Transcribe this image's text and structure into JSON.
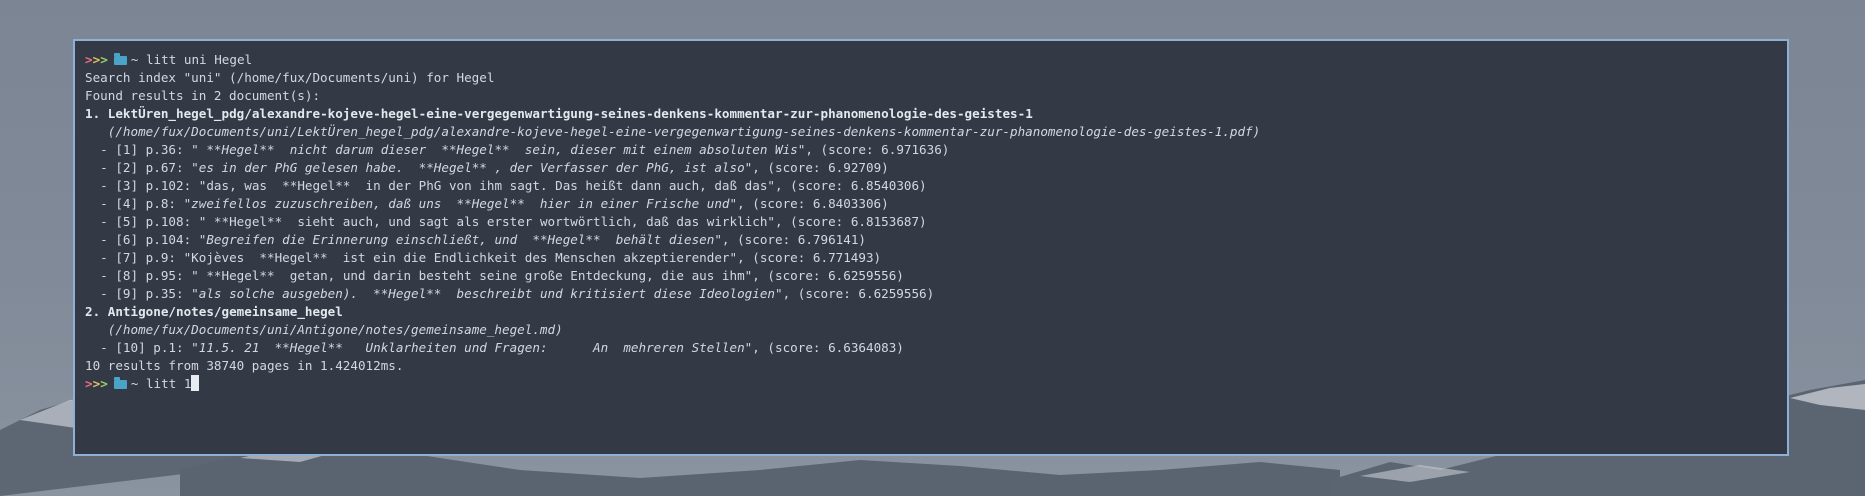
{
  "prompt": {
    "arrows": [
      ">",
      ">",
      ">"
    ],
    "folder_icon": "folder-icon",
    "tilde": "~"
  },
  "commands": {
    "first": "litt uni Hegel",
    "second": "litt 1"
  },
  "output": {
    "search_line": "Search index \"uni\" (/home/fux/Documents/uni) for Hegel",
    "found_line": "Found results in 2 document(s):",
    "summary_line": "10 results from 38740 pages in 1.424012ms."
  },
  "documents": [
    {
      "number": "1.",
      "title": "LektÜren_hegel_pdg/alexandre-kojeve-hegel-eine-vergegenwartigung-seines-denkens-kommentar-zur-phanomenologie-des-geistes-1",
      "path": "(/home/fux/Documents/uni/LektÜren_hegel_pdg/alexandre-kojeve-hegel-eine-vergegenwartigung-seines-denkens-kommentar-zur-phanomenologie-des-geistes-1.pdf)",
      "results": [
        {
          "prefix": "- [1] p.36: ",
          "snippet": "\" **Hegel**  nicht darum dieser  **Hegel**  sein, dieser mit einem absoluten Wis\"",
          "score": ", (score: 6.971636)"
        },
        {
          "prefix": "- [2] p.67: ",
          "snippet": "\"es in der PhG gelesen habe.  **Hegel** , der Verfasser der PhG, ist also\"",
          "score": ", (score: 6.92709)"
        },
        {
          "prefix": "- [3] p.102: ",
          "snippet": "\"das, was  **Hegel**  in der PhG von ihm sagt. Das heißt dann auch, daß das\"",
          "score": ", (score: 6.8540306)"
        },
        {
          "prefix": "- [4] p.8: ",
          "snippet": "\"zweifellos zuzuschreiben, daß uns  **Hegel**  hier in einer Frische und\"",
          "score": ", (score: 6.8403306)"
        },
        {
          "prefix": "- [5] p.108: ",
          "snippet": "\" **Hegel**  sieht auch, und sagt als erster wortwörtlich, daß das wirklich\"",
          "score": ", (score: 6.8153687)"
        },
        {
          "prefix": "- [6] p.104: ",
          "snippet": "\"Begreifen die Erinnerung einschließt, und  **Hegel**  behält diesen\"",
          "score": ", (score: 6.796141)"
        },
        {
          "prefix": "- [7] p.9: ",
          "snippet": "\"Kojèves  **Hegel**  ist ein die Endlichkeit des Menschen akzeptierender\"",
          "score": ", (score: 6.771493)"
        },
        {
          "prefix": "- [8] p.95: ",
          "snippet": "\" **Hegel**  getan, und darin besteht seine große Entdeckung, die aus ihm\"",
          "score": ", (score: 6.6259556)"
        },
        {
          "prefix": "- [9] p.35: ",
          "snippet": "\"als solche ausgeben).  **Hegel**  beschreibt und kritisiert diese Ideologien\"",
          "score": ", (score: 6.6259556)"
        }
      ]
    },
    {
      "number": "2.",
      "title": "Antigone/notes/gemeinsame_hegel",
      "path": "(/home/fux/Documents/uni/Antigone/notes/gemeinsame_hegel.md)",
      "results": [
        {
          "prefix": "- [10] p.1: ",
          "snippet": "\"11.5. 21  **Hegel**   Unklarheiten und Fragen:      An  mehreren Stellen\"",
          "score": ", (score: 6.6364083)"
        }
      ]
    }
  ],
  "colors": {
    "terminal_bg": "#333a46",
    "border": "#8fb0d4",
    "arrow_1": "#ec6f82",
    "arrow_2": "#e8c15d",
    "arrow_3": "#9bd06b",
    "folder": "#4aa3c8",
    "text": "#d3d8e0"
  }
}
